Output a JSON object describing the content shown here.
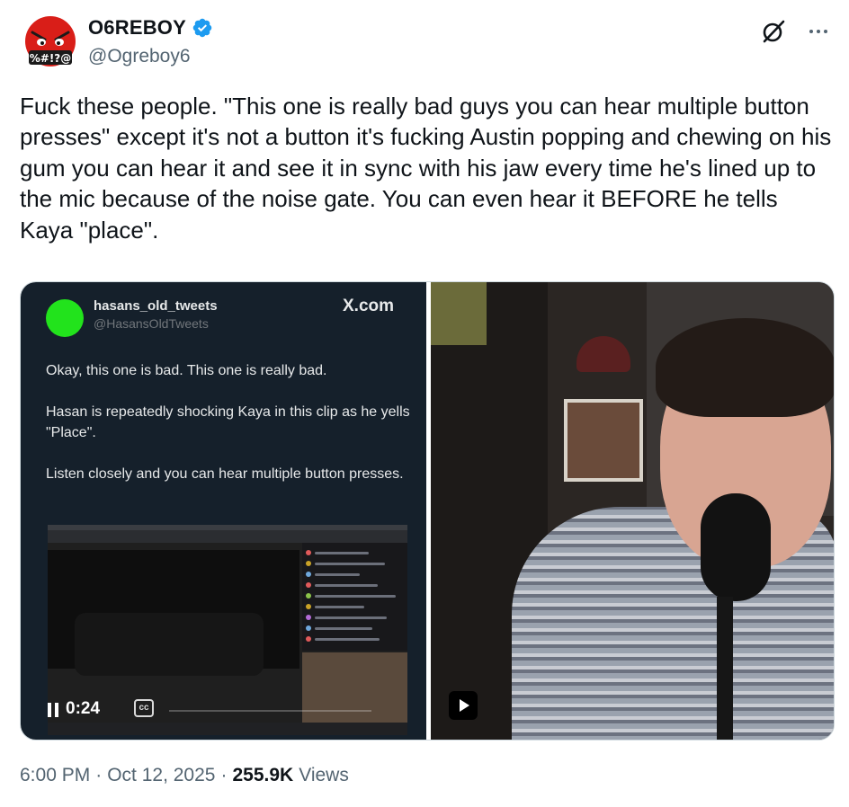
{
  "author": {
    "display_name": "O6REBOY",
    "handle": "@Ogreboy6",
    "avatar_icon": "angry-face-swearing-icon",
    "verified_icon": "verified-badge-icon",
    "verified_color": "#1d9bf0",
    "avatar_text": "%#!?@"
  },
  "header_actions": {
    "grok_icon": "grok-slash-circle-icon",
    "more_icon": "more-horizontal-icon"
  },
  "tweet": {
    "text": "Fuck these people. \"This one is really bad guys you can hear multiple button presses\" except it's not a button it's fucking Austin popping and chewing on his gum you can hear it and see it in sync with his jaw every time he's lined up to the mic because of the noise gate. You can even hear it BEFORE he tells Kaya \"place\"."
  },
  "media": {
    "left_video": {
      "embedded_name": "hasans_old_tweets",
      "embedded_handle": "@HasansOldTweets",
      "watermark": "X.com",
      "embedded_text": "Okay, this one is bad. This one is really bad.\n\nHasan is repeatedly shocking Kaya in this clip as he yells \"Place\".\n\nListen closely and you can hear multiple button presses.",
      "time": "0:24",
      "cc_label": "cc",
      "pause_icon": "pause-icon",
      "cc_icon": "closed-captions-icon"
    },
    "right_video": {
      "play_icon": "play-icon"
    }
  },
  "footer": {
    "time": "6:00 PM",
    "separator1": "·",
    "date": "Oct 12, 2025",
    "separator2": "·",
    "views_count": "255.9K",
    "views_label": "Views"
  }
}
